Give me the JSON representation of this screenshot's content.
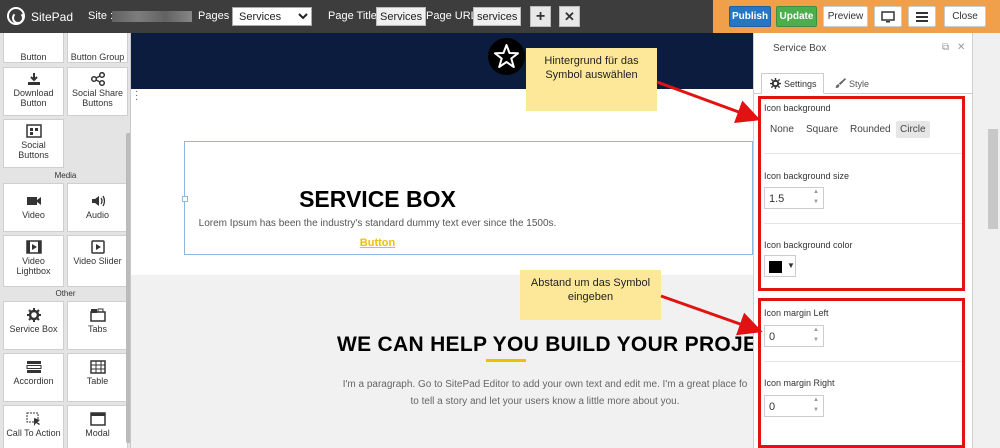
{
  "topbar": {
    "brand": "SitePad",
    "site_label": "Site :",
    "pages_label": "Pages :",
    "pages_selected": "Services",
    "page_title_label": "Page Title:",
    "page_title_value": "Services",
    "page_url_label": "Page URL:",
    "page_url_value": "services",
    "add_symbol": "+",
    "close_symbol": "✕",
    "publish": "Publish",
    "update": "Update",
    "preview": "Preview",
    "close": "Close"
  },
  "sidebar": {
    "top_items": [
      "Button",
      "Button Group"
    ],
    "items_row2": [
      "Download Button",
      "Social Share Buttons"
    ],
    "items_row3": [
      "Social Buttons"
    ],
    "section_media": "Media",
    "media_items": [
      "Video",
      "Audio",
      "Video Lightbox",
      "Video Slider"
    ],
    "section_other": "Other",
    "other_items": [
      "Service Box",
      "Tabs",
      "Accordion",
      "Table",
      "Call To Action",
      "Modal"
    ]
  },
  "canvas": {
    "service_title": "SERVICE BOX",
    "service_text": "Lorem Ipsum has been the industry's standard dummy text ever since the 1500s.",
    "service_button": "Button",
    "heading": "WE CAN HELP YOU BUILD YOUR PROJE",
    "para_line1": "I'm a paragraph. Go to SitePad Editor to add your own text and edit me. I'm a great place fo",
    "para_line2": "to tell a story and let your users know a little more about you."
  },
  "panel": {
    "title": "Service Box",
    "tab_settings": "Settings",
    "tab_style": "Style",
    "icon_background_label": "Icon background",
    "bg_options": [
      "None",
      "Square",
      "Rounded",
      "Circle"
    ],
    "bg_selected": "Circle",
    "bg_size_label": "Icon background size",
    "bg_size_value": "1.5",
    "bg_color_label": "Icon background color",
    "bg_color": "#000000",
    "margin_left_label": "Icon margin Left",
    "margin_left_value": "0",
    "margin_right_label": "Icon margin Right",
    "margin_right_value": "0"
  },
  "annotations": {
    "note1": "Hintergrund für das Symbol auswählen",
    "note2": "Abstand um das Symbol eingeben"
  },
  "colors": {
    "topbar": "#3d3d3d",
    "orange": "#f0a04a",
    "publish": "#2776c6",
    "update": "#4cae4c",
    "navy": "#0c1c3f",
    "accent": "#f0c000",
    "annotation_red": "#e21212",
    "note_bg": "#fde89a"
  }
}
